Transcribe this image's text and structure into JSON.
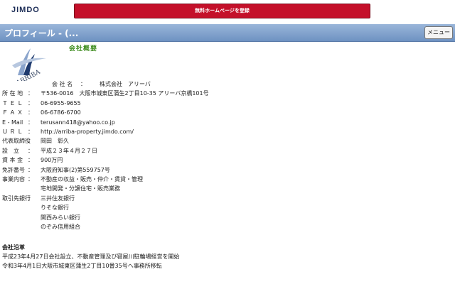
{
  "header": {
    "logo_text": "JIMDO",
    "register_label": "無料ホームページを登録"
  },
  "titlebar": {
    "title": "プロフィール - (...",
    "menu_label": "メニュー"
  },
  "company": {
    "logo_alt": "ARRIBA",
    "heading": "会社概要",
    "rows": [
      {
        "label": "会 社 名",
        "sep": "：",
        "value": "株式会社　アリーバ"
      },
      {
        "label": "所 在 地",
        "sep": "：",
        "value": "〒536-0016　大阪市城東区蒲生2丁目10-35 アリーバ京橋101号"
      },
      {
        "label": "Ｔ Ｅ Ｌ",
        "sep": "：",
        "value": "06-6955-9655"
      },
      {
        "label": "Ｆ Ａ Ｘ",
        "sep": "：",
        "value": "06-6786-6700"
      },
      {
        "label": "E - Mail",
        "sep": "：",
        "value": "terusann418@yahoo.co.jp"
      },
      {
        "label": "Ｕ Ｒ Ｌ",
        "sep": "：",
        "value": "http://arriba-property.jimdo.com/"
      },
      {
        "label": "代表取締役",
        "sep": "：",
        "value": "岡田　彰久"
      },
      {
        "label": "設　立",
        "sep": "：",
        "value": "平成２３年４月２７日"
      },
      {
        "label": "資 本 金",
        "sep": "：",
        "value": "900万円"
      },
      {
        "label": "免許番号",
        "sep": "：",
        "value": "大阪府知事(2)第559757号"
      },
      {
        "label": "事業内容",
        "sep": "：",
        "value": "不動産の収益・販売・仲介・賃貸・管理"
      },
      {
        "label": "",
        "sep": "",
        "value": "宅地開発・分譲住宅・販売業務"
      },
      {
        "label": "取引先銀行",
        "sep": "：",
        "value": "三井住友銀行"
      },
      {
        "label": "",
        "sep": "",
        "value": "りそな銀行"
      },
      {
        "label": "",
        "sep": "",
        "value": "関西みらい銀行"
      },
      {
        "label": "",
        "sep": "",
        "value": "のぞみ信用組合"
      }
    ]
  },
  "history": {
    "title": "会社沿革",
    "lines": [
      "平成23年4月27日会社設立、不動産管理及び寝屋川駐輪場経営を開始",
      "令和3年4月1日大阪市城東区蒲生2丁目10番35号へ事務所移転"
    ]
  }
}
